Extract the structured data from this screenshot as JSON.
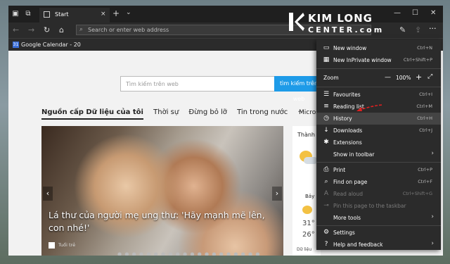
{
  "titlebar": {
    "tab_title": "Start",
    "tab_close": "×",
    "new_tab": "+",
    "tab_list": "⌄",
    "minimize": "—",
    "maximize": "☐",
    "close": "✕"
  },
  "navbar": {
    "back": "←",
    "forward": "→",
    "refresh": "↻",
    "home": "⌂",
    "address_placeholder": "Search or enter web address",
    "pen": "✎",
    "share": "⇪",
    "more": "···"
  },
  "favorites": {
    "item_icon": "31",
    "item_label": "Google Calendar - 20"
  },
  "logo": {
    "line1": "KIM LONG",
    "line2": "CENTER.com"
  },
  "page": {
    "search_placeholder": "Tìm kiếm trên web",
    "search_button": "tìm kiếm trên web",
    "tabs": [
      "Nguồn cấp Dữ liệu của tôi",
      "Thời sự",
      "Đừng bỏ lỡ",
      "Tin trong nước",
      "···"
    ],
    "micro": "Micros",
    "hero_caption": "Lá thư của người mẹ ung thư: 'Hãy mạnh mẽ lên, con nhé!'",
    "hero_source": "Tuổi trẻ",
    "hero_dots": "● ● ● ● ● ● ● ● ● ● ● ● ● ● ● ● ● ● ● ●",
    "arrow_left": "‹",
    "arrow_right": "›",
    "weather_title": "Thành",
    "weather_day": "Bảy",
    "weather_t1": "31°",
    "weather_t2": "26°",
    "weather_footer": "Dữ liệu"
  },
  "menu": {
    "new_window": {
      "label": "New window",
      "shortcut": "Ctrl+N"
    },
    "inprivate": {
      "label": "New InPrivate window",
      "shortcut": "Ctrl+Shift+P"
    },
    "zoom": {
      "label": "Zoom",
      "minus": "—",
      "value": "100%",
      "plus": "+",
      "fullscreen": "⤢"
    },
    "favourites": {
      "label": "Favourites",
      "shortcut": "Ctrl+I"
    },
    "reading_list": {
      "label": "Reading list",
      "shortcut": "Ctrl+M"
    },
    "history": {
      "label": "History",
      "shortcut": "Ctrl+H"
    },
    "downloads": {
      "label": "Downloads",
      "shortcut": "Ctrl+J"
    },
    "extensions": {
      "label": "Extensions"
    },
    "show_in_toolbar": {
      "label": "Show in toolbar",
      "chevron": "›"
    },
    "print": {
      "label": "Print",
      "shortcut": "Ctrl+P"
    },
    "find_on_page": {
      "label": "Find on page",
      "shortcut": "Ctrl+F"
    },
    "read_aloud": {
      "label": "Read aloud",
      "shortcut": "Ctrl+Shift+G"
    },
    "pin_taskbar": {
      "label": "Pin this page to the taskbar"
    },
    "more_tools": {
      "label": "More tools",
      "chevron": "›"
    },
    "settings": {
      "label": "Settings"
    },
    "help": {
      "label": "Help and feedback",
      "chevron": "›"
    }
  },
  "colors": {
    "accent_blue": "#1e9be8",
    "annotation_red": "#e02020",
    "menu_bg": "#2b2b2b"
  }
}
